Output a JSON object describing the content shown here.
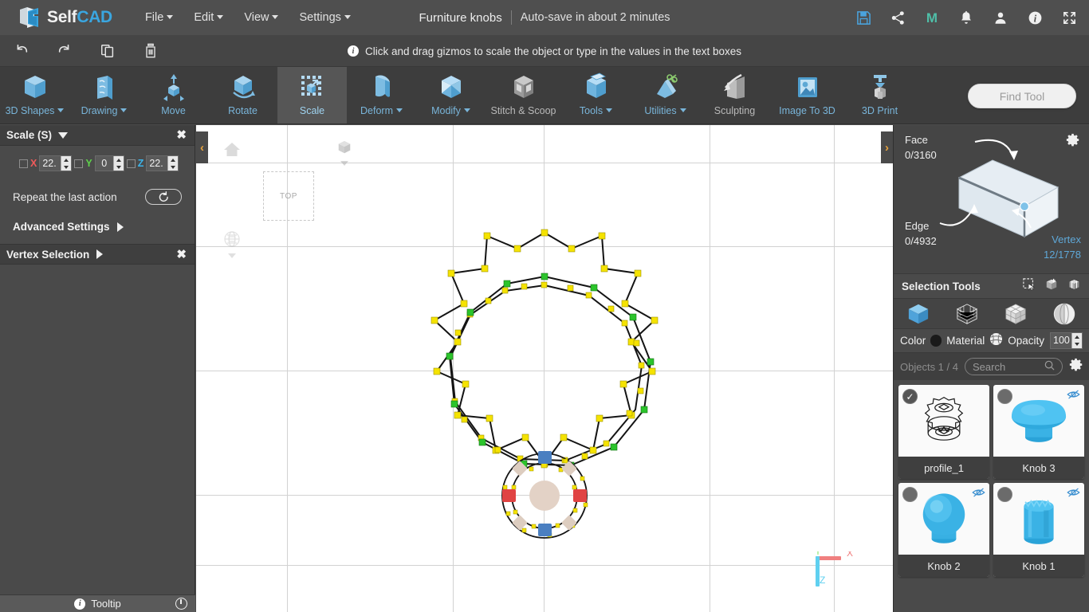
{
  "app": {
    "brand_self": "Self",
    "brand_cad": "CAD",
    "accent_blue": "#3aa6e0",
    "panel_bg": "#4a4a4a"
  },
  "menubar": {
    "items": [
      {
        "label": "File",
        "has_caret": true
      },
      {
        "label": "Edit",
        "has_caret": true
      },
      {
        "label": "View",
        "has_caret": true
      },
      {
        "label": "Settings",
        "has_caret": true
      }
    ],
    "document_title": "Furniture knobs",
    "autosave_text": "Auto-save in about 2 minutes",
    "icons": [
      "save-icon",
      "share-icon",
      "magic-m-icon",
      "bell-icon",
      "user-icon",
      "info-icon",
      "fullscreen-icon"
    ]
  },
  "actionbar": {
    "buttons": [
      "undo-icon",
      "redo-icon",
      "copy-icon",
      "delete-icon"
    ],
    "hint": "Click and drag gizmos to scale the object or type in the values in the text boxes"
  },
  "ribbon": {
    "tools": [
      {
        "label": "3D Shapes",
        "icon": "cube-icon",
        "caret": true,
        "active": false,
        "dim": false
      },
      {
        "label": "Drawing",
        "icon": "drawing-icon",
        "caret": true,
        "active": false,
        "dim": false
      },
      {
        "label": "Move",
        "icon": "move-icon",
        "caret": false,
        "active": false,
        "dim": false
      },
      {
        "label": "Rotate",
        "icon": "rotate-icon",
        "caret": false,
        "active": false,
        "dim": false
      },
      {
        "label": "Scale",
        "icon": "scale-icon",
        "caret": false,
        "active": true,
        "dim": false
      },
      {
        "label": "Deform",
        "icon": "deform-icon",
        "caret": true,
        "active": false,
        "dim": false
      },
      {
        "label": "Modify",
        "icon": "modify-icon",
        "caret": true,
        "active": false,
        "dim": false
      },
      {
        "label": "Stitch & Scoop",
        "icon": "stitch-scoop-icon",
        "caret": false,
        "active": false,
        "dim": true
      },
      {
        "label": "Tools",
        "icon": "tools-icon",
        "caret": true,
        "active": false,
        "dim": false
      },
      {
        "label": "Utilities",
        "icon": "utilities-icon",
        "caret": true,
        "active": false,
        "dim": false
      },
      {
        "label": "Sculpting",
        "icon": "sculpting-icon",
        "caret": false,
        "active": false,
        "dim": true
      },
      {
        "label": "Image To 3D",
        "icon": "image-to-3d-icon",
        "caret": false,
        "active": false,
        "dim": false
      },
      {
        "label": "3D Print",
        "icon": "3d-print-icon",
        "caret": false,
        "active": false,
        "dim": false
      }
    ],
    "find_tool_placeholder": "Find Tool"
  },
  "left_panel": {
    "title": "Scale (S)",
    "axes": [
      {
        "axis": "X",
        "value": "22.",
        "color": "#f05a5a",
        "checked": false
      },
      {
        "axis": "Y",
        "value": "0",
        "color": "#5ed14b",
        "checked": false
      },
      {
        "axis": "Z",
        "value": "22.",
        "color": "#3cb4ea",
        "checked": false
      }
    ],
    "repeat_label": "Repeat the last action",
    "advanced_label": "Advanced Settings",
    "vertex_selection_label": "Vertex Selection",
    "tooltip_label": "Tooltip"
  },
  "viewport": {
    "view_cube_label": "TOP",
    "collapse_left_icon": "chevron-left-icon",
    "collapse_right_icon": "chevron-right-icon",
    "axis_x": "X",
    "axis_y": "Y",
    "axis_z": "Z",
    "axis_colors": {
      "x": "#f08080",
      "y": "#8ee870",
      "z": "#5fd0f0"
    }
  },
  "right_panel": {
    "selection": {
      "face_label": "Face",
      "face_count": "0/3160",
      "edge_label": "Edge",
      "edge_count": "0/4932",
      "vertex_label": "Vertex",
      "vertex_count": "12/1778",
      "active_mode": "vertex"
    },
    "selection_tools_label": "Selection Tools",
    "selection_tools_icons": [
      "rect-select-icon",
      "box-select-icon",
      "loop-select-icon"
    ],
    "mode_icons": [
      "object-mode-icon",
      "vertex-mode-icon",
      "face-mode-icon",
      "edge-mode-icon"
    ],
    "color_label": "Color",
    "color_value": "#1a1a1a",
    "material_label": "Material",
    "opacity_label": "Opacity",
    "opacity_value": "100",
    "objects_label": "Objects 1 / 4",
    "search_placeholder": "Search",
    "objects": [
      {
        "name": "profile_1",
        "selected": true,
        "hidden": false,
        "thumb": "profile-wireframe"
      },
      {
        "name": "Knob 3",
        "selected": false,
        "hidden": true,
        "thumb": "knob-mushroom"
      },
      {
        "name": "Knob 2",
        "selected": false,
        "hidden": true,
        "thumb": "knob-sphere"
      },
      {
        "name": "Knob 1",
        "selected": false,
        "hidden": true,
        "thumb": "knob-cylinder"
      }
    ]
  }
}
